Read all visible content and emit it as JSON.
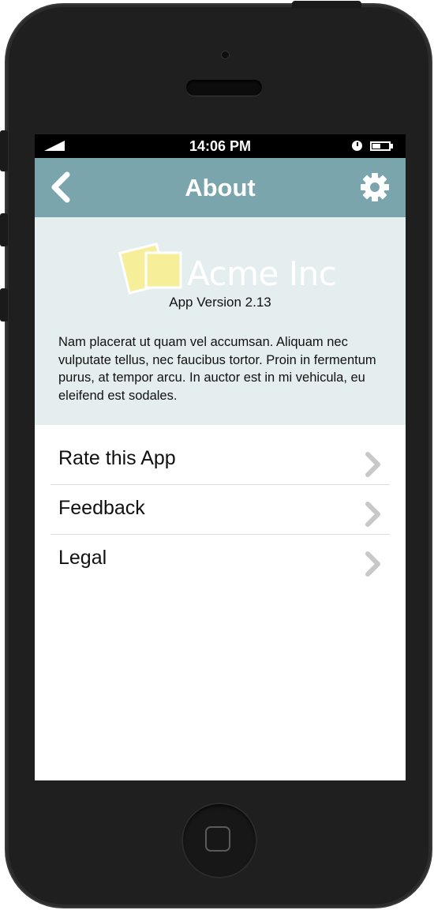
{
  "status_bar": {
    "time": "14:06 PM"
  },
  "navbar": {
    "title": "About",
    "back_icon": "chevron-left-icon",
    "settings_icon": "gear-icon"
  },
  "info": {
    "logo_text": "Acme Inc",
    "version": "App Version 2.13",
    "description": "Nam placerat ut quam vel accumsan. Aliquam nec vulputate tellus, nec faucibus tortor. Proin in fermentum purus, at tempor arcu. In auctor est in mi vehicula, eu eleifend est sodales."
  },
  "menu": {
    "items": [
      {
        "label": "Rate this App"
      },
      {
        "label": "Feedback"
      },
      {
        "label": "Legal"
      }
    ]
  },
  "colors": {
    "navbar": "#7aa5ad",
    "info_background": "#e5eeef",
    "logo_yellow": "#f7ee9a",
    "chevron": "#c8c8c8"
  }
}
